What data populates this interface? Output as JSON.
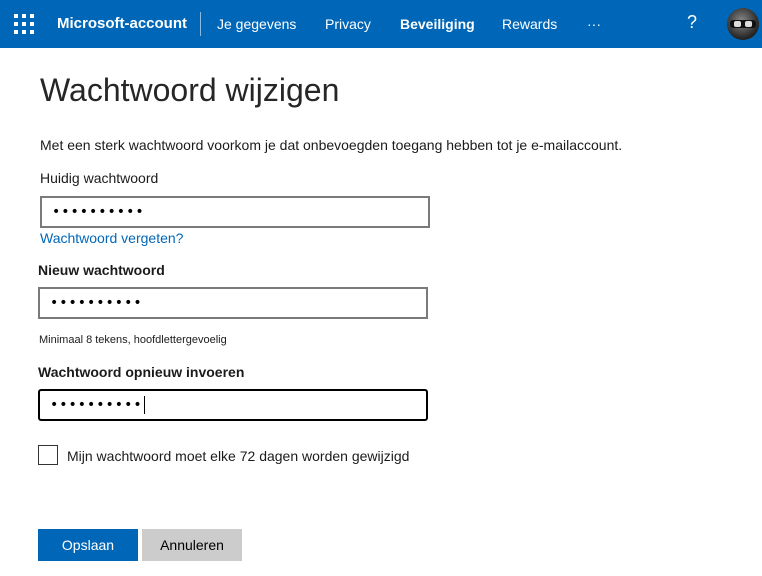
{
  "header": {
    "brand": "Microsoft-account",
    "nav": [
      "Je gegevens",
      "Privacy",
      "Beveiliging",
      "Rewards",
      "···"
    ],
    "active_nav": "Beveiliging",
    "help": "?",
    "accent_color": "#0067b8"
  },
  "page": {
    "title": "Wachtwoord wijzigen",
    "intro": "Met een sterk wachtwoord voorkom je dat onbevoegden toegang hebben tot je e-mailaccount."
  },
  "form": {
    "current_label": "Huidig wachtwoord",
    "current_value": "••••••••••",
    "forgot_link": "Wachtwoord vergeten?",
    "new_label": "Nieuw wachtwoord",
    "new_value": "••••••••••",
    "hint": "Minimaal 8 tekens, hoofdlettergevoelig",
    "repeat_label": "Wachtwoord opnieuw invoeren",
    "repeat_value": "••••••••••",
    "checkbox_label": "Mijn wachtwoord moet elke 72 dagen worden gewijzigd",
    "checkbox_checked": false
  },
  "buttons": {
    "save": "Opslaan",
    "cancel": "Annuleren"
  }
}
